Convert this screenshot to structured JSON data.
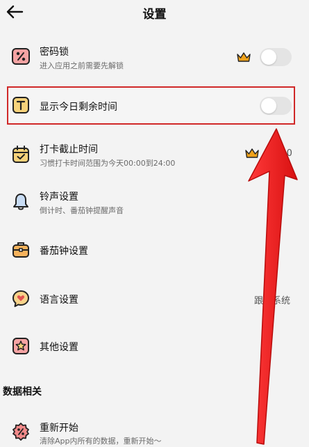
{
  "header": {
    "back_icon": "arrow-left-icon",
    "title": "设置"
  },
  "settings": {
    "password_lock": {
      "icon": "percent-tag-icon",
      "title": "密码锁",
      "subtitle": "进入应用之前需要先解锁",
      "premium_icon": "crown-icon",
      "enabled": false
    },
    "show_remaining_time": {
      "icon": "letter-t-icon",
      "title": "显示今日剩余时间",
      "enabled": false
    },
    "checkin_deadline": {
      "icon": "calendar-check-icon",
      "title": "打卡截止时间",
      "subtitle": "习惯打卡时间范围为今天00:00到24:00",
      "premium_icon": "crown-icon",
      "value_visible": ":00"
    },
    "ringtone": {
      "icon": "bell-icon",
      "title": "铃声设置",
      "subtitle": "倒计时、番茄钟提醒声音"
    },
    "pomodoro": {
      "icon": "briefcase-icon",
      "title": "番茄钟设置"
    },
    "language": {
      "icon": "heart-chat-icon",
      "title": "语言设置",
      "value": "跟随系统"
    },
    "other": {
      "icon": "star-icon",
      "title": "其他设置"
    }
  },
  "data_section": {
    "title": "数据相关",
    "restart": {
      "icon": "percent-gear-icon",
      "title": "重新开始",
      "subtitle": "清除App内所有的数据，重新开始～"
    }
  },
  "annotation": {
    "arrow_color": "#e81c1c",
    "highlight_color": "#d02828"
  },
  "colors": {
    "background": "#f3f3f3",
    "toggle_off": "#e4e4e4",
    "crown_gold": "#f0a21a"
  }
}
